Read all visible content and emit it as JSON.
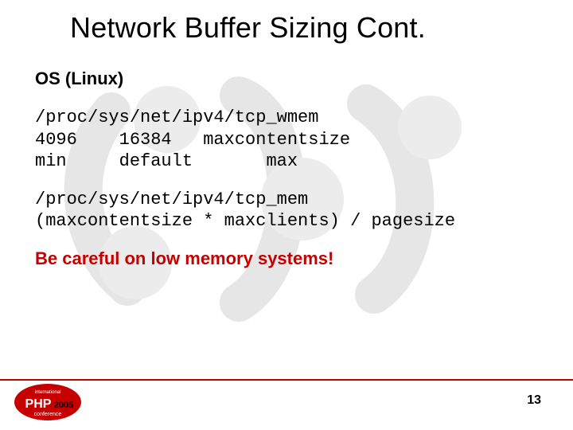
{
  "title": "Network Buffer Sizing Cont.",
  "subhead": "OS (Linux)",
  "block1_line1": "/proc/sys/net/ipv4/tcp_wmem",
  "block1_line2": "4096    16384   maxcontentsize",
  "block1_line3": "min     default       max",
  "block2_line1": "/proc/sys/net/ipv4/tcp_mem",
  "block2_line2": "(maxcontentsize * maxclients) / pagesize",
  "warn": "Be careful on low memory systems!",
  "page_num": "13",
  "logo": {
    "top": "international",
    "brand": "PHP",
    "year": "2005",
    "sub": "conference"
  }
}
